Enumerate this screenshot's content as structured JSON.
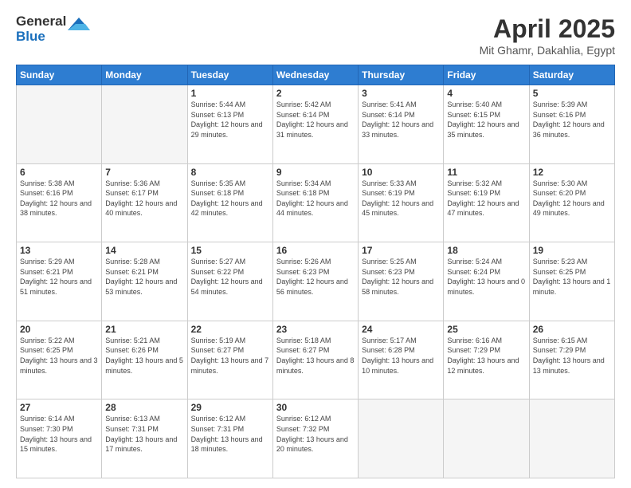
{
  "logo": {
    "general": "General",
    "blue": "Blue"
  },
  "title": "April 2025",
  "location": "Mit Ghamr, Dakahlia, Egypt",
  "days_header": [
    "Sunday",
    "Monday",
    "Tuesday",
    "Wednesday",
    "Thursday",
    "Friday",
    "Saturday"
  ],
  "weeks": [
    [
      {
        "day": "",
        "sunrise": "",
        "sunset": "",
        "daylight": ""
      },
      {
        "day": "",
        "sunrise": "",
        "sunset": "",
        "daylight": ""
      },
      {
        "day": "1",
        "sunrise": "Sunrise: 5:44 AM",
        "sunset": "Sunset: 6:13 PM",
        "daylight": "Daylight: 12 hours and 29 minutes."
      },
      {
        "day": "2",
        "sunrise": "Sunrise: 5:42 AM",
        "sunset": "Sunset: 6:14 PM",
        "daylight": "Daylight: 12 hours and 31 minutes."
      },
      {
        "day": "3",
        "sunrise": "Sunrise: 5:41 AM",
        "sunset": "Sunset: 6:14 PM",
        "daylight": "Daylight: 12 hours and 33 minutes."
      },
      {
        "day": "4",
        "sunrise": "Sunrise: 5:40 AM",
        "sunset": "Sunset: 6:15 PM",
        "daylight": "Daylight: 12 hours and 35 minutes."
      },
      {
        "day": "5",
        "sunrise": "Sunrise: 5:39 AM",
        "sunset": "Sunset: 6:16 PM",
        "daylight": "Daylight: 12 hours and 36 minutes."
      }
    ],
    [
      {
        "day": "6",
        "sunrise": "Sunrise: 5:38 AM",
        "sunset": "Sunset: 6:16 PM",
        "daylight": "Daylight: 12 hours and 38 minutes."
      },
      {
        "day": "7",
        "sunrise": "Sunrise: 5:36 AM",
        "sunset": "Sunset: 6:17 PM",
        "daylight": "Daylight: 12 hours and 40 minutes."
      },
      {
        "day": "8",
        "sunrise": "Sunrise: 5:35 AM",
        "sunset": "Sunset: 6:18 PM",
        "daylight": "Daylight: 12 hours and 42 minutes."
      },
      {
        "day": "9",
        "sunrise": "Sunrise: 5:34 AM",
        "sunset": "Sunset: 6:18 PM",
        "daylight": "Daylight: 12 hours and 44 minutes."
      },
      {
        "day": "10",
        "sunrise": "Sunrise: 5:33 AM",
        "sunset": "Sunset: 6:19 PM",
        "daylight": "Daylight: 12 hours and 45 minutes."
      },
      {
        "day": "11",
        "sunrise": "Sunrise: 5:32 AM",
        "sunset": "Sunset: 6:19 PM",
        "daylight": "Daylight: 12 hours and 47 minutes."
      },
      {
        "day": "12",
        "sunrise": "Sunrise: 5:30 AM",
        "sunset": "Sunset: 6:20 PM",
        "daylight": "Daylight: 12 hours and 49 minutes."
      }
    ],
    [
      {
        "day": "13",
        "sunrise": "Sunrise: 5:29 AM",
        "sunset": "Sunset: 6:21 PM",
        "daylight": "Daylight: 12 hours and 51 minutes."
      },
      {
        "day": "14",
        "sunrise": "Sunrise: 5:28 AM",
        "sunset": "Sunset: 6:21 PM",
        "daylight": "Daylight: 12 hours and 53 minutes."
      },
      {
        "day": "15",
        "sunrise": "Sunrise: 5:27 AM",
        "sunset": "Sunset: 6:22 PM",
        "daylight": "Daylight: 12 hours and 54 minutes."
      },
      {
        "day": "16",
        "sunrise": "Sunrise: 5:26 AM",
        "sunset": "Sunset: 6:23 PM",
        "daylight": "Daylight: 12 hours and 56 minutes."
      },
      {
        "day": "17",
        "sunrise": "Sunrise: 5:25 AM",
        "sunset": "Sunset: 6:23 PM",
        "daylight": "Daylight: 12 hours and 58 minutes."
      },
      {
        "day": "18",
        "sunrise": "Sunrise: 5:24 AM",
        "sunset": "Sunset: 6:24 PM",
        "daylight": "Daylight: 13 hours and 0 minutes."
      },
      {
        "day": "19",
        "sunrise": "Sunrise: 5:23 AM",
        "sunset": "Sunset: 6:25 PM",
        "daylight": "Daylight: 13 hours and 1 minute."
      }
    ],
    [
      {
        "day": "20",
        "sunrise": "Sunrise: 5:22 AM",
        "sunset": "Sunset: 6:25 PM",
        "daylight": "Daylight: 13 hours and 3 minutes."
      },
      {
        "day": "21",
        "sunrise": "Sunrise: 5:21 AM",
        "sunset": "Sunset: 6:26 PM",
        "daylight": "Daylight: 13 hours and 5 minutes."
      },
      {
        "day": "22",
        "sunrise": "Sunrise: 5:19 AM",
        "sunset": "Sunset: 6:27 PM",
        "daylight": "Daylight: 13 hours and 7 minutes."
      },
      {
        "day": "23",
        "sunrise": "Sunrise: 5:18 AM",
        "sunset": "Sunset: 6:27 PM",
        "daylight": "Daylight: 13 hours and 8 minutes."
      },
      {
        "day": "24",
        "sunrise": "Sunrise: 5:17 AM",
        "sunset": "Sunset: 6:28 PM",
        "daylight": "Daylight: 13 hours and 10 minutes."
      },
      {
        "day": "25",
        "sunrise": "Sunrise: 6:16 AM",
        "sunset": "Sunset: 7:29 PM",
        "daylight": "Daylight: 13 hours and 12 minutes."
      },
      {
        "day": "26",
        "sunrise": "Sunrise: 6:15 AM",
        "sunset": "Sunset: 7:29 PM",
        "daylight": "Daylight: 13 hours and 13 minutes."
      }
    ],
    [
      {
        "day": "27",
        "sunrise": "Sunrise: 6:14 AM",
        "sunset": "Sunset: 7:30 PM",
        "daylight": "Daylight: 13 hours and 15 minutes."
      },
      {
        "day": "28",
        "sunrise": "Sunrise: 6:13 AM",
        "sunset": "Sunset: 7:31 PM",
        "daylight": "Daylight: 13 hours and 17 minutes."
      },
      {
        "day": "29",
        "sunrise": "Sunrise: 6:12 AM",
        "sunset": "Sunset: 7:31 PM",
        "daylight": "Daylight: 13 hours and 18 minutes."
      },
      {
        "day": "30",
        "sunrise": "Sunrise: 6:12 AM",
        "sunset": "Sunset: 7:32 PM",
        "daylight": "Daylight: 13 hours and 20 minutes."
      },
      {
        "day": "",
        "sunrise": "",
        "sunset": "",
        "daylight": ""
      },
      {
        "day": "",
        "sunrise": "",
        "sunset": "",
        "daylight": ""
      },
      {
        "day": "",
        "sunrise": "",
        "sunset": "",
        "daylight": ""
      }
    ]
  ]
}
